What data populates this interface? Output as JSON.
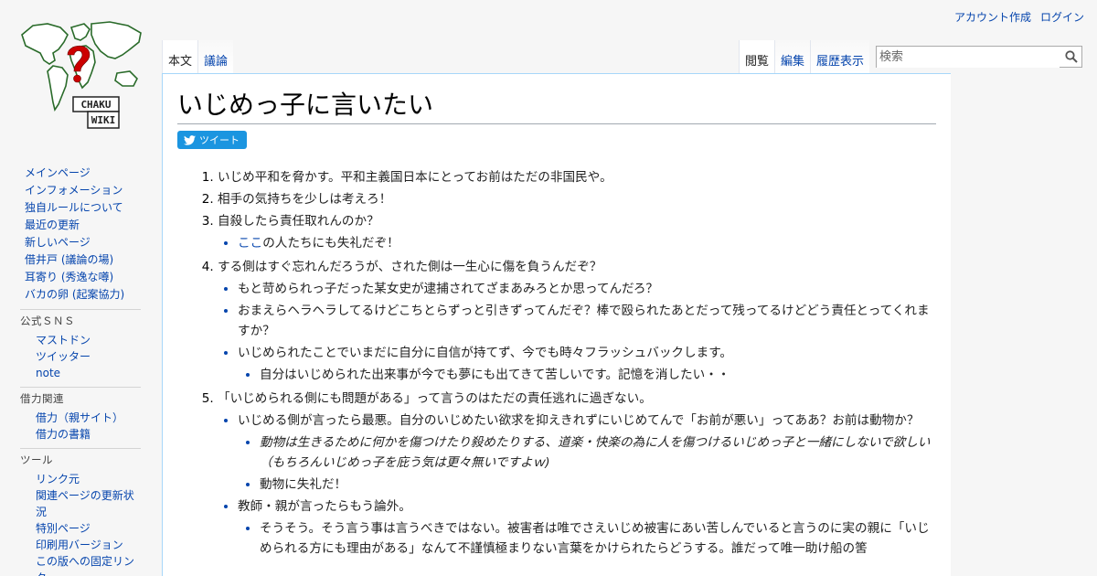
{
  "personal": {
    "create_account": "アカウント作成",
    "login": "ログイン"
  },
  "logo": {
    "text_line1": "CHAKU",
    "text_line2": "WIKI"
  },
  "tabs_left": [
    "本文",
    "議論"
  ],
  "tabs_right": [
    "閲覧",
    "編集",
    "履歴表示"
  ],
  "search": {
    "placeholder": "検索"
  },
  "navigation": [
    "メインページ",
    "インフォメーション",
    "独自ルールについて",
    "最近の更新",
    "新しいページ",
    "借井戸 (議論の場)",
    "耳寄り (秀逸な噂)",
    "バカの卵 (起案協力)"
  ],
  "sns": {
    "heading": "公式ＳＮＳ",
    "items": [
      "マストドン",
      "ツイッター",
      "note"
    ]
  },
  "related": {
    "heading": "借力関連",
    "items": [
      "借力（親サイト）",
      "借力の書籍"
    ]
  },
  "tools": {
    "heading": "ツール",
    "items": [
      "リンク元",
      "関連ページの更新状況",
      "特別ページ",
      "印刷用バージョン",
      "この版への固定リンク"
    ]
  },
  "page": {
    "title": "いじめっ子に言いたい",
    "tweet_label": "ツイート",
    "items": {
      "i1": "いじめ平和を脅かす。平和主義国日本にとってお前はただの非国民や。",
      "i2": "相手の気持ちを少しは考えろ！",
      "i3": "自殺したら責任取れんのか？",
      "i3_link": "ここ",
      "i3_sub": "の人たちにも失礼だぞ！",
      "i4": "する側はすぐ忘れんだろうが、された側は一生心に傷を負うんだぞ？",
      "i4_a": "もと苛められっ子だった某女史が逮捕されてざまあみろとか思ってんだろ？",
      "i4_b": "おまえらヘラヘラしてるけどこちとらずっと引きずってんだぞ？棒で殴られたあとだって残ってるけどどう責任とってくれますか？",
      "i4_c": "いじめられたことでいまだに自分に自信が持てず、今でも時々フラッシュバックします。",
      "i4_c1": "自分はいじめられた出来事が今でも夢にも出てきて苦しいです。記憶を消したい・・",
      "i5": "「いじめられる側にも問題がある」って言うのはただの責任逃れに過ぎない。",
      "i5_a": "いじめる側が言ったら最悪。自分のいじめたい欲求を抑えきれずにいじめてんで「お前が悪い」ってああ？お前は動物か？",
      "i5_a1": "動物は生きるために何かを傷つけたり殺めたりする、道楽・快楽の為に人を傷つけるいじめっ子と一緒にしないで欲しい（もちろんいじめっ子を庇う気は更々無いですよｗ)",
      "i5_a2": "動物に失礼だ！",
      "i5_b": "教師・親が言ったらもう論外。",
      "i5_b1": "そうそう。そう言う事は言うべきではない。被害者は唯でさえいじめ被害にあい苦しんでいると言うのに実の親に「いじめられる方にも理由がある」なんて不謹慎極まりない言葉をかけられたらどうする。誰だって唯一助け船の筈"
    }
  }
}
